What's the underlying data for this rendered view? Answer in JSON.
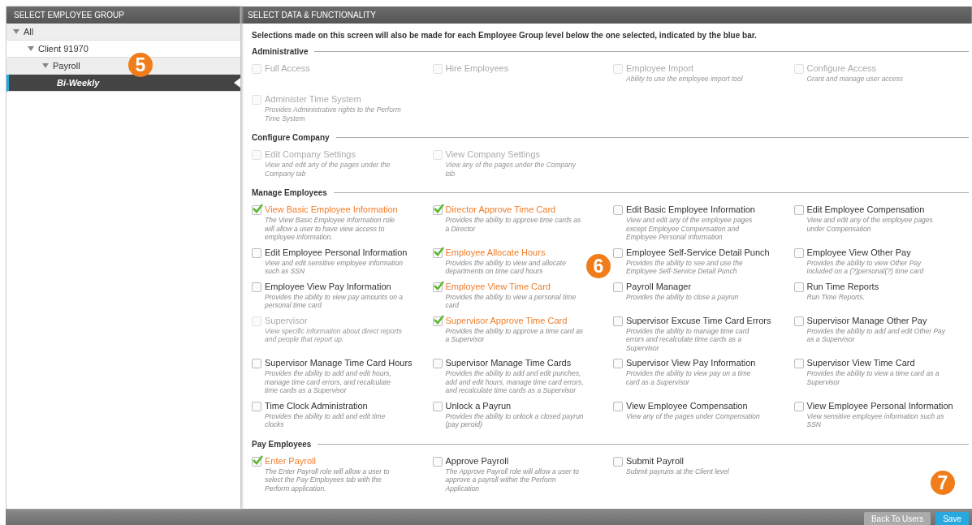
{
  "left_panel": {
    "title": "SELECT EMPLOYEE GROUP",
    "tree": [
      {
        "label": "All",
        "selected": false,
        "expanded": true,
        "children": [
          {
            "label": "Client 91970",
            "selected": false,
            "expanded": true,
            "children": [
              {
                "label": "Payroll",
                "selected": false,
                "expanded": true,
                "children": [
                  {
                    "label": "Bi-Weekly",
                    "selected": true
                  }
                ]
              }
            ]
          }
        ]
      }
    ]
  },
  "right_panel": {
    "title": "SELECT DATA & FUNCTIONALITY",
    "intro": "Selections made on this screen will also be made for each Employee Group level below the one selected, indicated by the blue bar.",
    "sections": [
      {
        "title": "Administrative",
        "items": [
          {
            "label": "Full Access",
            "checked": false,
            "disabled": true
          },
          {
            "label": "Hire Employees",
            "checked": false,
            "disabled": true
          },
          {
            "label": "Employee Import",
            "description": "Ability to use the employee import tool",
            "checked": false,
            "disabled": true
          },
          {
            "label": "Configure Access",
            "description": "Grant and manage user access",
            "checked": false,
            "disabled": true
          },
          {
            "label": "Administer Time System",
            "description": "Provides Administrative rights to the Perform Time System",
            "checked": false,
            "disabled": true
          }
        ]
      },
      {
        "title": "Configure Company",
        "items": [
          {
            "label": "Edit Company Settings",
            "description": "View and edit any of the pages under the Company tab",
            "checked": false,
            "disabled": true
          },
          {
            "label": "View Company Settings",
            "description": "View any of the pages under the Company tab",
            "checked": false,
            "disabled": true
          }
        ]
      },
      {
        "title": "Manage Employees",
        "items": [
          {
            "label": "View Basic Employee Information",
            "description": "The View Basic Employee Information role will allow a user to have view access to employee information.",
            "checked": true,
            "disabled": false
          },
          {
            "label": "Director Approve Time Card",
            "description": "Provides the ability to approve time cards as a Director",
            "checked": true,
            "disabled": false
          },
          {
            "label": "Edit Basic Employee Information",
            "description": "View and edit any of the employee pages except Employee Compensation and Employee Personal Information",
            "checked": false,
            "disabled": false
          },
          {
            "label": "Edit Employee Compensation",
            "description": "View and edit any of the employee pages under Compensation",
            "checked": false,
            "disabled": false
          },
          {
            "label": "Edit Employee Personal Information",
            "description": "View and edit sensitive employee information such as SSN",
            "checked": false,
            "disabled": false
          },
          {
            "label": "Employee Allocate Hours",
            "description": "Provides the ability to view and allocate departments on time card hours",
            "checked": true,
            "disabled": false
          },
          {
            "label": "Employee Self-Service Detail Punch",
            "description": "Provides the ability to see and use the Employee Self-Service Detail Punch",
            "checked": false,
            "disabled": false
          },
          {
            "label": "Employee View Other Pay",
            "description": "Provides the ability to view Other Pay included on a (?)personal(?) time card",
            "checked": false,
            "disabled": false
          },
          {
            "label": "Employee View Pay Information",
            "description": "Provides the ability to view pay amounts on a personal time card",
            "checked": false,
            "disabled": false
          },
          {
            "label": "Employee View Time Card",
            "description": "Provides the ability to view a personal time card",
            "checked": true,
            "disabled": false
          },
          {
            "label": "Payroll Manager",
            "description": "Provides the ability to close a payrun",
            "checked": false,
            "disabled": false
          },
          {
            "label": "Run Time Reports",
            "description": "Run Time Reports.",
            "checked": false,
            "disabled": false
          },
          {
            "label": "Supervisor",
            "description": "View specific information about direct reports and people that report up.",
            "checked": false,
            "disabled": true
          },
          {
            "label": "Supervisor Approve Time Card",
            "description": "Provides the ability to approve a time card as a Supervisor",
            "checked": true,
            "disabled": false
          },
          {
            "label": "Supervisor Excuse Time Card Errors",
            "description": "Provides the ability to manage time card errors and recalculate time cards as a Supervisor",
            "checked": false,
            "disabled": false
          },
          {
            "label": "Supervisor Manage Other Pay",
            "description": "Provides the ability to add and edit Other Pay as a Supervisor",
            "checked": false,
            "disabled": false
          },
          {
            "label": "Supervisor Manage Time Card Hours",
            "description": "Provides the ability to add and edit hours, manage time card errors, and recalculate time cards as a Supervisor",
            "checked": false,
            "disabled": false
          },
          {
            "label": "Supervisor Manage Time Cards",
            "description": "Provides the ability to add and edit punches, add and edit hours, manage time card errors, and recalculate time cards as a Supervisor",
            "checked": false,
            "disabled": false
          },
          {
            "label": "Supervisor View Pay Information",
            "description": "Provides the ability to view pay on a time card as a Supervisor",
            "checked": false,
            "disabled": false
          },
          {
            "label": "Supervisor View Time Card",
            "description": "Provides the ability to view a time card as a Supervisor",
            "checked": false,
            "disabled": false
          },
          {
            "label": "Time Clock Administration",
            "description": "Provides the ability to add and edit time clocks",
            "checked": false,
            "disabled": false
          },
          {
            "label": "Unlock a Payrun",
            "description": "Provides the ability to unlock a closed payrun (pay peroid)",
            "checked": false,
            "disabled": false
          },
          {
            "label": "View Employee Compensation",
            "description": "View any of the pages under Compensation",
            "checked": false,
            "disabled": false
          },
          {
            "label": "View Employee Personal Information",
            "description": "View sensitive employee information such as SSN",
            "checked": false,
            "disabled": false
          }
        ]
      },
      {
        "title": "Pay Employees",
        "items": [
          {
            "label": "Enter Payroll",
            "description": "The Enter Payroll role will allow a user to select the Pay Employees tab with the Perform application.",
            "checked": true,
            "disabled": false
          },
          {
            "label": "Approve Payroll",
            "description": "The Approve Payroll role will allow a user to approve a payroll within the Perform Application",
            "checked": false,
            "disabled": false
          },
          {
            "label": "Submit Payroll",
            "description": "Submit payruns at the Client level",
            "checked": false,
            "disabled": false
          }
        ]
      }
    ]
  },
  "footer": {
    "buttons": [
      {
        "label": "Back To Users",
        "kind": "secondary"
      },
      {
        "label": "Save",
        "kind": "primary"
      }
    ]
  },
  "callouts": [
    "5",
    "6",
    "7"
  ]
}
